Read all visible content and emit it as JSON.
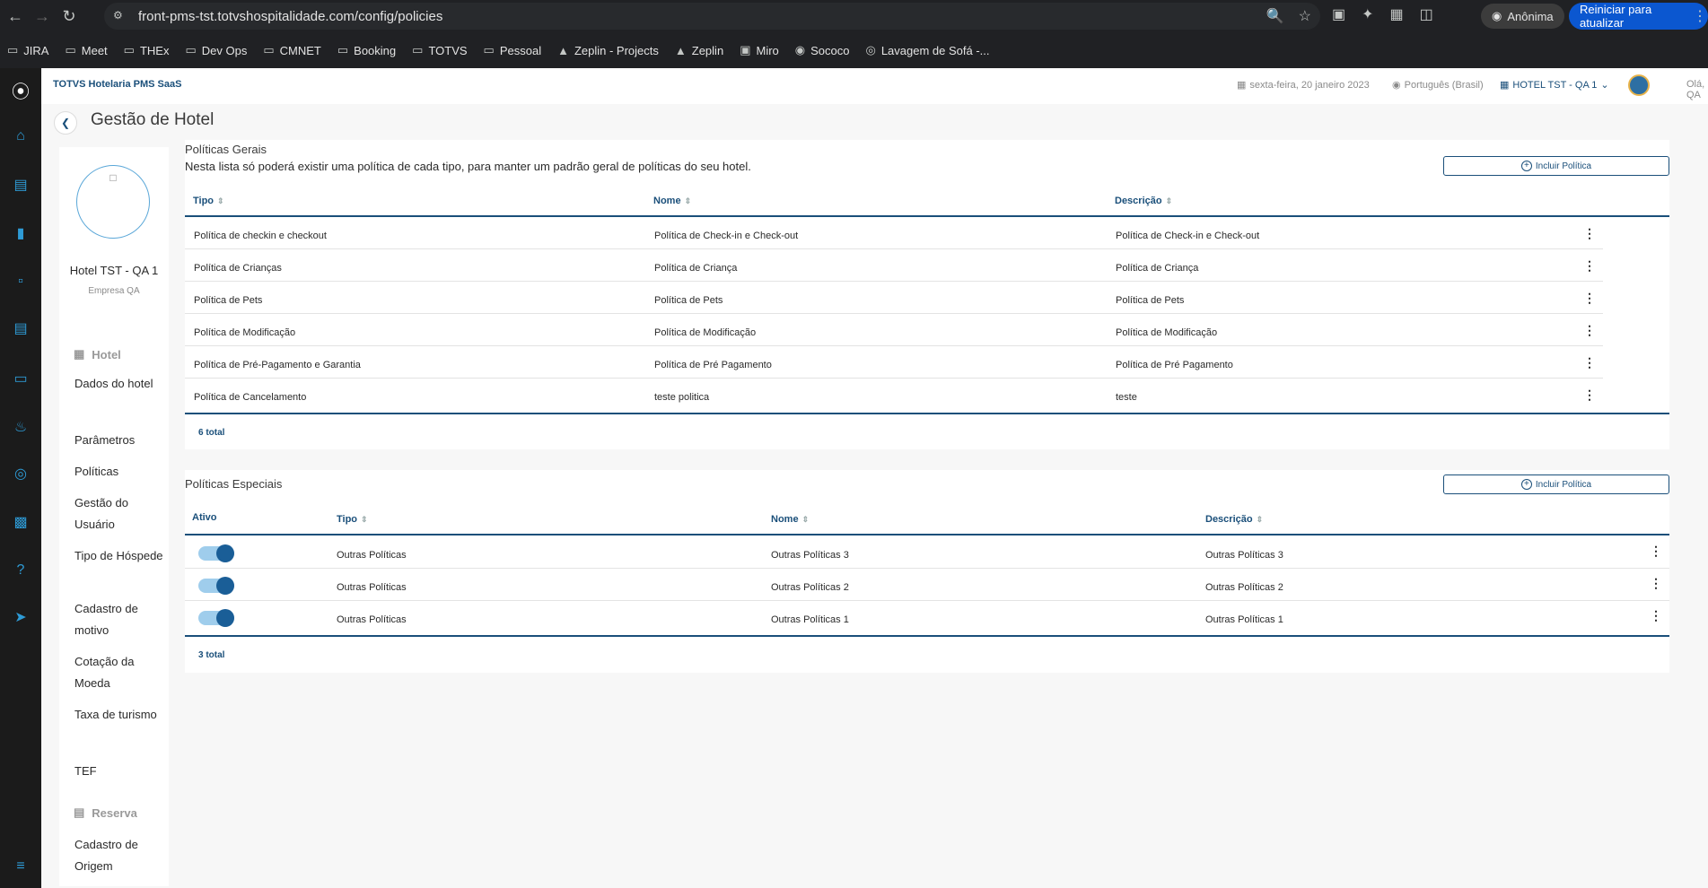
{
  "browser": {
    "url": "front-pms-tst.totvshospitalidade.com/config/policies",
    "incognito_label": "Anônima",
    "update_label": "Reiniciar para atualizar",
    "bookmarks": [
      {
        "label": "JIRA",
        "icon": "folder-icon"
      },
      {
        "label": "Meet",
        "icon": "folder-icon"
      },
      {
        "label": "THEx",
        "icon": "folder-icon"
      },
      {
        "label": "Dev Ops",
        "icon": "folder-icon"
      },
      {
        "label": "CMNET",
        "icon": "folder-icon"
      },
      {
        "label": "Booking",
        "icon": "folder-icon"
      },
      {
        "label": "TOTVS",
        "icon": "folder-icon"
      },
      {
        "label": "Pessoal",
        "icon": "folder-icon"
      },
      {
        "label": "Zeplin - Projects",
        "icon": "zeplin-icon"
      },
      {
        "label": "Zeplin",
        "icon": "zeplin-icon"
      },
      {
        "label": "Miro",
        "icon": "miro-icon"
      },
      {
        "label": "Sococo",
        "icon": "sococo-icon"
      },
      {
        "label": "Lavagem de Sofá -...",
        "icon": "globe-icon"
      }
    ]
  },
  "header": {
    "brand": "TOTVS Hotelaria PMS SaaS",
    "date": "sexta-feira, 20 janeiro 2023",
    "language": "Português (Brasil)",
    "hotel": "HOTEL TST - QA 1",
    "greeting": "Olá, QA"
  },
  "page": {
    "title": "Gestão de Hotel"
  },
  "sidebar": {
    "hotel_name": "Hotel TST - QA 1",
    "company": "Empresa QA",
    "section_hotel": "Hotel",
    "section_reserva": "Reserva",
    "links": [
      "Dados do hotel",
      "Parâmetros",
      "Políticas",
      "Gestão do Usuário",
      "Tipo de Hóspede",
      "Cadastro de motivo",
      "Cotação da Moeda",
      "Taxa de turismo",
      "TEF"
    ],
    "reserva_links": [
      "Cadastro de Origem"
    ]
  },
  "general_policies": {
    "title": "Políticas Gerais",
    "subtitle": "Nesta lista só poderá existir uma política de cada tipo, para manter um padrão geral de políticas do seu hotel.",
    "add_button": "Incluir Política",
    "columns": [
      "Tipo",
      "Nome",
      "Descrição"
    ],
    "rows": [
      [
        "Política de checkin e checkout",
        "Política de Check-in e Check-out",
        "Política de Check-in e Check-out"
      ],
      [
        "Política de Crianças",
        "Política de Criança",
        "Política de Criança"
      ],
      [
        "Política de Pets",
        "Política de Pets",
        "Política de Pets"
      ],
      [
        "Política de Modificação",
        "Política de Modificação",
        "Política de Modificação"
      ],
      [
        "Política de Pré-Pagamento e Garantia",
        "Política de Pré Pagamento",
        "Política de Pré Pagamento"
      ],
      [
        "Política de Cancelamento",
        "teste politica",
        "teste"
      ]
    ],
    "total": "6 total"
  },
  "special_policies": {
    "title": "Políticas Especiais",
    "add_button": "Incluir Política",
    "columns": [
      "Ativo",
      "Tipo",
      "Nome",
      "Descrição"
    ],
    "rows": [
      {
        "active": true,
        "tipo": "Outras Políticas",
        "nome": "Outras Políticas 3",
        "descricao": "Outras Políticas 3"
      },
      {
        "active": true,
        "tipo": "Outras Políticas",
        "nome": "Outras Políticas 2",
        "descricao": "Outras Políticas 2"
      },
      {
        "active": true,
        "tipo": "Outras Políticas",
        "nome": "Outras Políticas 1",
        "descricao": "Outras Políticas 1"
      }
    ],
    "total": "3 total"
  },
  "colors": {
    "accent": "#1a4f7a",
    "rail_icon": "#2e9bd6",
    "toggle_track": "#9fcdec",
    "toggle_knob": "#1a5e97"
  }
}
